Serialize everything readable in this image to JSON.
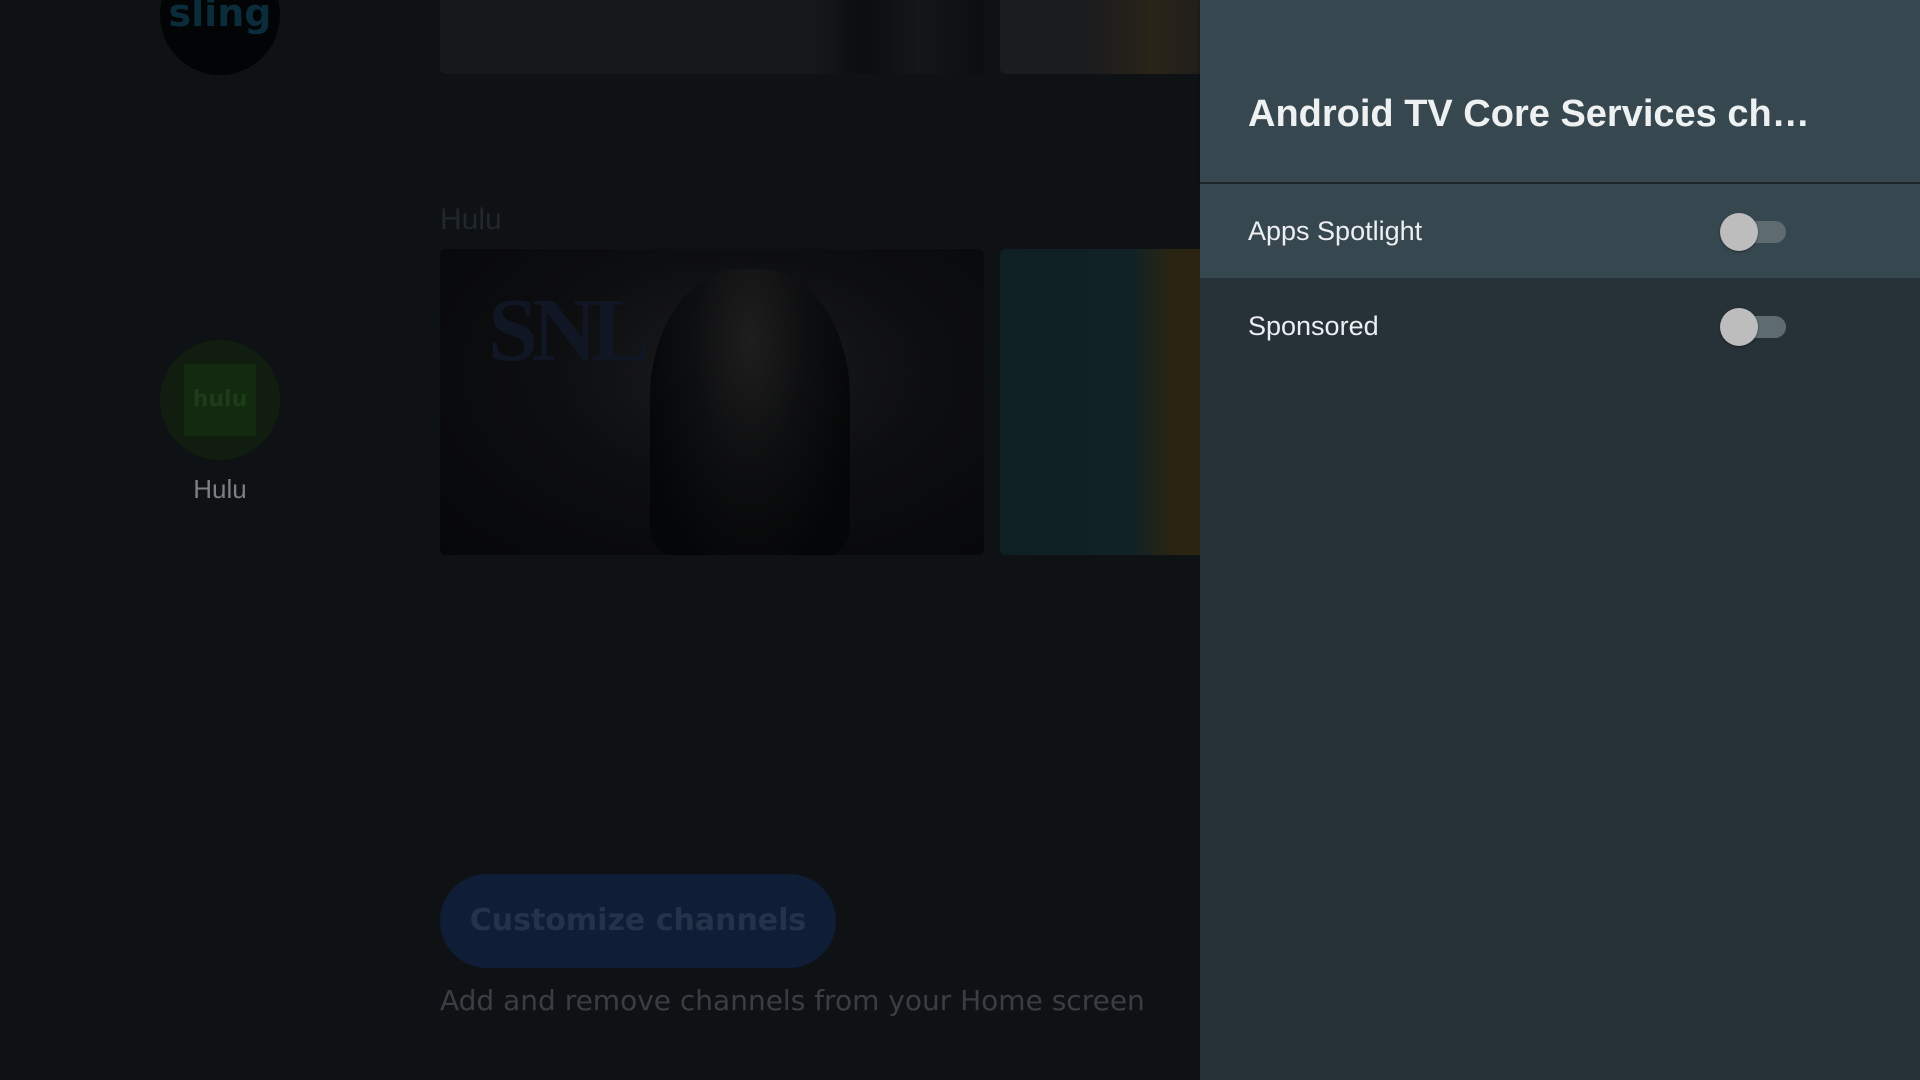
{
  "home": {
    "apps": [
      {
        "name": "sling"
      },
      {
        "name": "hulu",
        "label": "Hulu"
      }
    ],
    "hulu_row_title": "Hulu",
    "snl_art_text": "SNL",
    "customize_button_label": "Customize channels",
    "customize_description": "Add and remove channels from your Home screen"
  },
  "panel": {
    "title": "Android TV Core Services ch…",
    "items": [
      {
        "label": "Apps Spotlight",
        "enabled": false,
        "focused": true
      },
      {
        "label": "Sponsored",
        "enabled": false,
        "focused": false
      }
    ]
  },
  "colors": {
    "panel_background": "#263238",
    "panel_header": "#37474f",
    "toggle_thumb_off": "#bdbdbd",
    "toggle_track_off": "#5e6b71"
  }
}
